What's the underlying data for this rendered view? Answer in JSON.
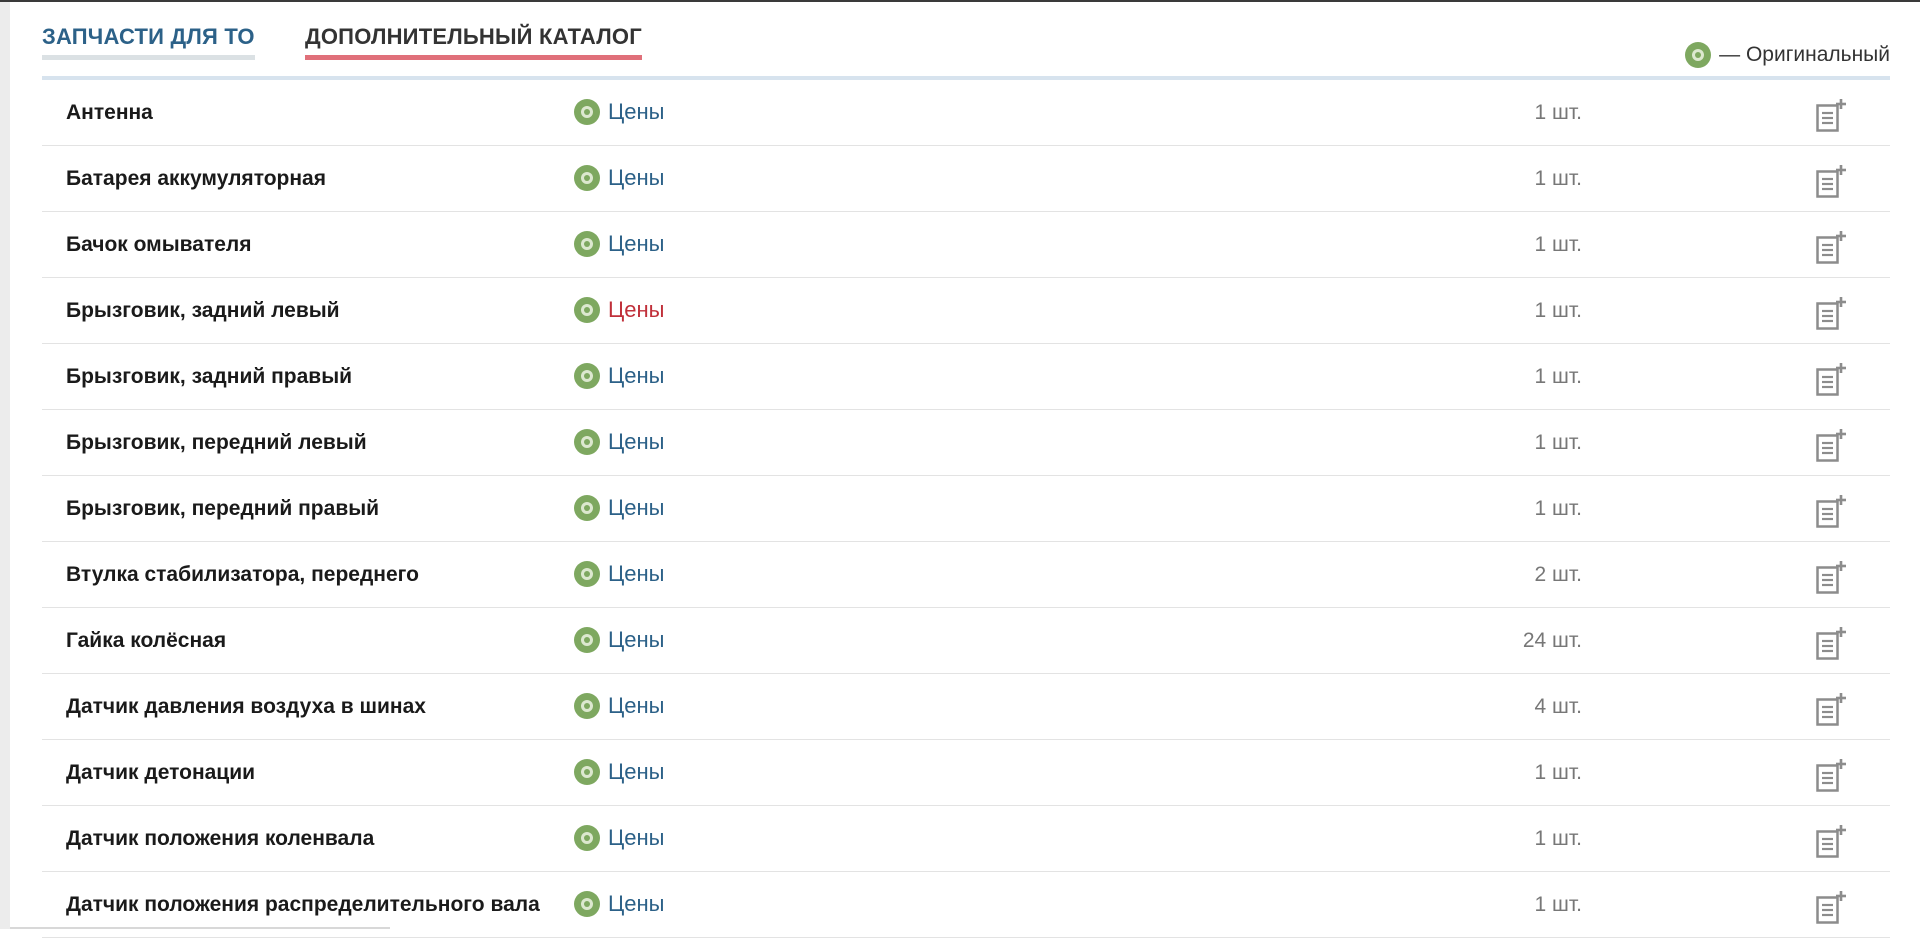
{
  "tabs": {
    "to_label": "ЗАПЧАСТИ ДЛЯ ТО",
    "extra_label": "ДОПОЛНИТЕЛЬНЫЙ КАТАЛОГ"
  },
  "legend": {
    "icon": "original-circle-icon",
    "label": "— Оригинальный"
  },
  "colors": {
    "accent_blue": "#2c6188",
    "accent_red": "#c0303a",
    "original_green": "#7ea860",
    "active_tab_underline": "#e0707a"
  },
  "rows": [
    {
      "name": "Антенна",
      "prices": "Цены",
      "qty": "1 шт.",
      "prices_red": false
    },
    {
      "name": "Батарея аккумуляторная",
      "prices": "Цены",
      "qty": "1 шт.",
      "prices_red": false
    },
    {
      "name": "Бачок омывателя",
      "prices": "Цены",
      "qty": "1 шт.",
      "prices_red": false
    },
    {
      "name": "Брызговик, задний левый",
      "prices": "Цены",
      "qty": "1 шт.",
      "prices_red": true
    },
    {
      "name": "Брызговик, задний правый",
      "prices": "Цены",
      "qty": "1 шт.",
      "prices_red": false
    },
    {
      "name": "Брызговик, передний левый",
      "prices": "Цены",
      "qty": "1 шт.",
      "prices_red": false
    },
    {
      "name": "Брызговик, передний правый",
      "prices": "Цены",
      "qty": "1 шт.",
      "prices_red": false
    },
    {
      "name": "Втулка стабилизатора, переднего",
      "prices": "Цены",
      "qty": "2 шт.",
      "prices_red": false
    },
    {
      "name": "Гайка колёсная",
      "prices": "Цены",
      "qty": "24 шт.",
      "prices_red": false
    },
    {
      "name": "Датчик давления воздуха в шинах",
      "prices": "Цены",
      "qty": "4 шт.",
      "prices_red": false
    },
    {
      "name": "Датчик детонации",
      "prices": "Цены",
      "qty": "1 шт.",
      "prices_red": false
    },
    {
      "name": "Датчик положения коленвала",
      "prices": "Цены",
      "qty": "1 шт.",
      "prices_red": false
    },
    {
      "name": "Датчик положения распределительного вала",
      "prices": "Цены",
      "qty": "1 шт.",
      "prices_red": false
    }
  ]
}
